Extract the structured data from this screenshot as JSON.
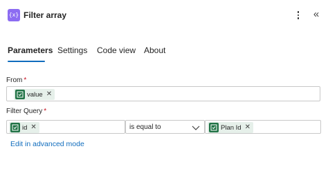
{
  "header": {
    "title": "Filter array",
    "app_icon_glyph": "{x}",
    "app_icon_color": "#8c6cf2",
    "more_icon": "more-vertical-icon",
    "collapse_icon": "double-chevron-left-icon"
  },
  "tabs": [
    {
      "label": "Parameters",
      "active": true
    },
    {
      "label": "Settings",
      "active": false
    },
    {
      "label": "Code view",
      "active": false
    },
    {
      "label": "About",
      "active": false
    }
  ],
  "from": {
    "label": "From",
    "required_mark": "*",
    "token": {
      "text": "value",
      "icon": "planner-icon"
    }
  },
  "filter_query": {
    "label": "Filter Query",
    "required_mark": "*",
    "left_token": {
      "text": "id",
      "icon": "planner-icon"
    },
    "operator": "is equal to",
    "right_token": {
      "text": "Plan Id",
      "icon": "planner-icon"
    }
  },
  "advanced_link": "Edit in advanced mode",
  "colors": {
    "accent": "#0f6cbd",
    "token_icon": "#217346",
    "token_bg": "#e6f0ea",
    "required": "#c50f1f"
  }
}
